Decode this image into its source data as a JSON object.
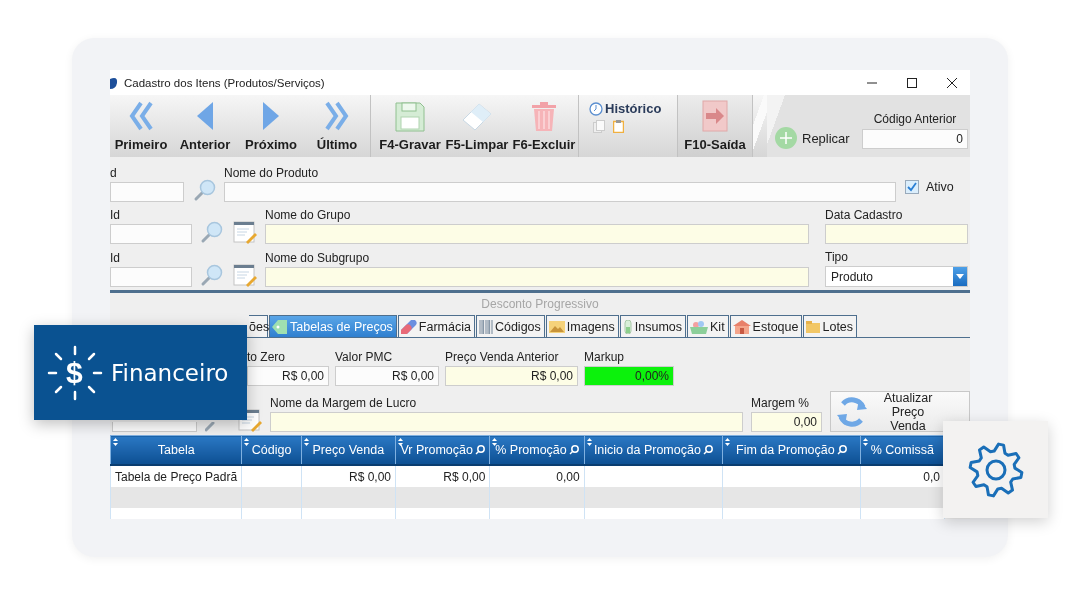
{
  "window": {
    "title": "Cadastro dos Itens (Produtos/Serviços)"
  },
  "toolbar": {
    "groups": [
      [
        {
          "kind": "first",
          "label": "Primeiro"
        },
        {
          "kind": "prev",
          "label": "Anterior"
        },
        {
          "kind": "next",
          "label": "Próximo"
        },
        {
          "kind": "last",
          "label": "Último"
        }
      ],
      [
        {
          "kind": "save",
          "label": "F4-Gravar"
        },
        {
          "kind": "clear",
          "label": "F5-Limpar"
        },
        {
          "kind": "delete",
          "label": "F6-Excluir"
        }
      ],
      [
        {
          "kind": "history",
          "label": "Histórico"
        }
      ],
      [
        {
          "kind": "exit",
          "label": "F10-Saída"
        }
      ]
    ],
    "replicate": {
      "label": "Replicar"
    },
    "previous_code": {
      "label": "Código Anterior",
      "value": "0"
    }
  },
  "form": {
    "rows": [
      [
        {
          "kind": "field",
          "label": "d"
        },
        {
          "kind": "search"
        },
        {
          "kind": "field",
          "label": "Nome do Produto"
        },
        {
          "kind": "checkbox",
          "label": "Ativo",
          "checked": true
        }
      ],
      [
        {
          "kind": "field",
          "label": "Id"
        },
        {
          "kind": "search"
        },
        {
          "kind": "notepad"
        },
        {
          "kind": "field",
          "label": "Nome do Grupo",
          "readonly": true
        },
        {
          "kind": "field",
          "label": "Data Cadastro",
          "readonly": true
        }
      ],
      [
        {
          "kind": "field",
          "label": "Id"
        },
        {
          "kind": "search"
        },
        {
          "kind": "notepad"
        },
        {
          "kind": "field",
          "label": "Nome do Subgrupo",
          "readonly": true
        },
        {
          "kind": "select",
          "label": "Tipo",
          "value": "Produto"
        }
      ]
    ]
  },
  "section": {
    "label": "Desconto Progressivo",
    "disabled": true
  },
  "tabs": [
    {
      "label": "ões",
      "selected": false
    },
    {
      "kind": "tag",
      "label": "Tabelas de Preços",
      "selected": true
    },
    {
      "kind": "pill",
      "label": "Farmácia",
      "selected": false
    },
    {
      "kind": "barcode",
      "label": "Códigos",
      "selected": false
    },
    {
      "kind": "image",
      "label": "Imagens",
      "selected": false
    },
    {
      "kind": "vial",
      "label": "Insumos",
      "selected": false
    },
    {
      "kind": "basket",
      "label": "Kit",
      "selected": false
    },
    {
      "kind": "house",
      "label": "Estoque",
      "selected": false
    },
    {
      "kind": "folder",
      "label": "Lotes",
      "selected": false
    }
  ],
  "price_fields": [
    {
      "kind": "field",
      "label": "to Zero",
      "value": "R$ 0,00"
    },
    {
      "kind": "field",
      "label": "Valor PMC",
      "value": "R$ 0,00"
    },
    {
      "kind": "field",
      "label": "Preço Venda Anterior",
      "value": "R$ 0,00",
      "readonly": true
    },
    {
      "kind": "markup",
      "label": "Markup",
      "value": "0,00%"
    }
  ],
  "margin_row": [
    {
      "kind": "stub"
    },
    {
      "kind": "search-stub"
    },
    {
      "kind": "notepad"
    },
    {
      "kind": "field",
      "label": "Nome da Margem de Lucro",
      "readonly": true
    },
    {
      "kind": "field",
      "label": "Margem %",
      "value": "0,00",
      "readonly": true
    },
    {
      "kind": "button",
      "label": "Atualizar Preço Venda"
    }
  ],
  "table": {
    "columns": [
      {
        "label": "Tabela",
        "searchable": false
      },
      {
        "label": "Código",
        "searchable": false
      },
      {
        "label": "Preço Venda",
        "searchable": false
      },
      {
        "label": "Vr Promoção",
        "searchable": true
      },
      {
        "label": "% Promoção",
        "searchable": true
      },
      {
        "label": "Inicio da Promoção",
        "searchable": true
      },
      {
        "label": "Fim da Promoção",
        "searchable": true
      },
      {
        "label": "% Comissã",
        "searchable": false
      }
    ],
    "rows": [
      {
        "cells": [
          "Tabela de Preço Padrã",
          null,
          "R$ 0,00",
          "R$ 0,00",
          "0,00",
          null,
          null,
          "0,0"
        ]
      }
    ]
  },
  "badge": {
    "symbol": "$",
    "label": "Financeiro"
  }
}
